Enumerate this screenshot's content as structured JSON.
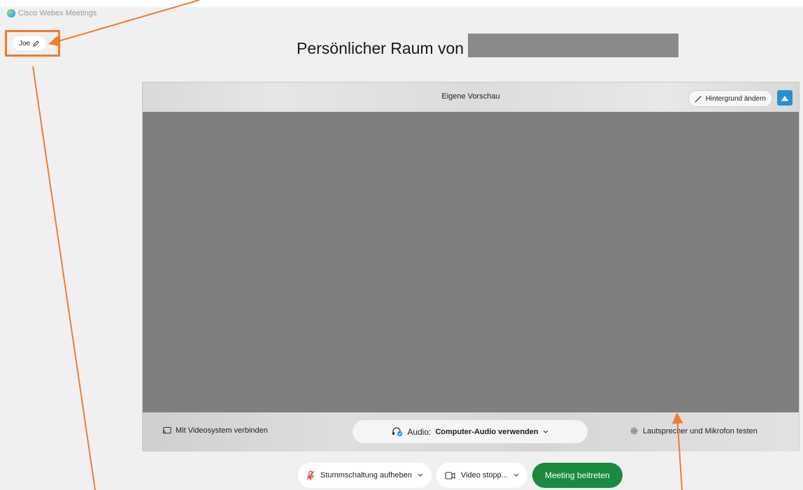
{
  "window": {
    "title": "Cisco Webex Meetings"
  },
  "user": {
    "name": "Joe"
  },
  "room": {
    "title": "Persönlicher Raum von"
  },
  "preview": {
    "label": "Eigene Vorschau",
    "background_button": "Hintergrund ändern"
  },
  "footer": {
    "connect_video_system": "Mit Videosystem verbinden",
    "audio_prefix": "Audio:",
    "audio_value": "Computer-Audio verwenden",
    "test_audio": "Lautsprecher und Mikrofon testen"
  },
  "controls": {
    "unmute": "Stummschaltung aufheben",
    "video": "Video stopp...",
    "join": "Meeting beitreten"
  },
  "colors": {
    "annotation": "#ed7d31",
    "join": "#1a8a3f",
    "accent": "#2a8fce"
  }
}
